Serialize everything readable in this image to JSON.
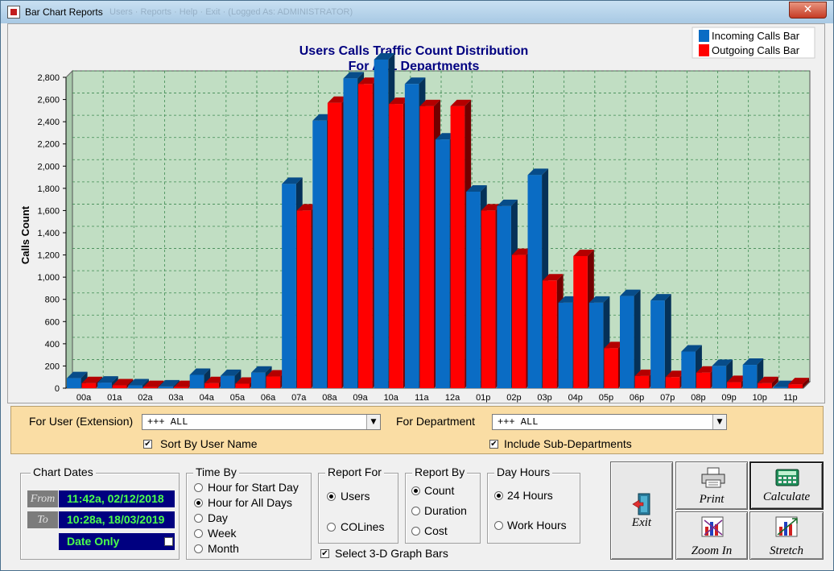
{
  "window": {
    "title": "Bar Chart Reports",
    "menu_ghost": "Users · Reports · Help · Exit · (Logged As: ADMINISTRATOR)",
    "close_glyph": "✕"
  },
  "chart_data": {
    "type": "bar",
    "title": "Users Calls Traffic Count Distribution",
    "subtitle": "For ALL Departments",
    "ylabel": "Calls Count",
    "xlabel": "",
    "ylim": [
      0,
      2800
    ],
    "yticks": [
      "0",
      "200",
      "400",
      "600",
      "800",
      "1,000",
      "1,200",
      "1,400",
      "1,600",
      "1,800",
      "2,000",
      "2,200",
      "2,400",
      "2,600",
      "2,800"
    ],
    "grid": true,
    "legend_position": "top-right",
    "three_d": true,
    "categories": [
      "00a",
      "01a",
      "02a",
      "03a",
      "04a",
      "05a",
      "06a",
      "07a",
      "08a",
      "09a",
      "10a",
      "11a",
      "12a",
      "01p",
      "02p",
      "03p",
      "04p",
      "05p",
      "06p",
      "07p",
      "08p",
      "09p",
      "10p",
      "11p"
    ],
    "series": [
      {
        "name": "Incoming Calls Bar",
        "color": "#0a6cc4",
        "values": [
          90,
          50,
          25,
          15,
          120,
          110,
          140,
          1840,
          2410,
          2790,
          2960,
          2740,
          2240,
          1770,
          1640,
          1920,
          770,
          770,
          830,
          790,
          330,
          200,
          210,
          10
        ]
      },
      {
        "name": "Outgoing Calls Bar",
        "color": "#ff0000",
        "values": [
          45,
          25,
          10,
          10,
          45,
          40,
          105,
          1600,
          2570,
          2740,
          2560,
          2540,
          2540,
          1600,
          1200,
          970,
          1190,
          360,
          110,
          100,
          140,
          55,
          45,
          35
        ]
      }
    ],
    "colors": {
      "plot_bg": "#c1dec3",
      "grid": "#3f8a52",
      "title": "#000080"
    }
  },
  "filters": {
    "user_label": "For User (Extension)",
    "user_value": "+++ ALL",
    "dept_label": "For Department",
    "dept_value": "+++ ALL",
    "sort_label": "Sort By User Name",
    "sort_checked": "✔",
    "subdept_label": "Include Sub-Departments",
    "subdept_checked": "✔"
  },
  "chart_dates": {
    "title": "Chart  Dates",
    "from_tag": "From",
    "from_value": "11:42a, 02/12/2018",
    "to_tag": "To",
    "to_value": "10:28a, 18/03/2019",
    "date_only_label": "Date Only"
  },
  "time_by": {
    "title": "Time By",
    "options": [
      "Hour for Start Day",
      "Hour for All Days",
      "Day",
      "Week",
      "Month"
    ],
    "selected": "Hour for All Days"
  },
  "report_for": {
    "title": "Report For",
    "options": [
      "Users",
      "COLines"
    ],
    "selected": "Users"
  },
  "report_by": {
    "title": "Report By",
    "options": [
      "Count",
      "Duration",
      "Cost"
    ],
    "selected": "Count"
  },
  "day_hours": {
    "title": "Day Hours",
    "options": [
      "24 Hours",
      "Work Hours"
    ],
    "selected": "24 Hours"
  },
  "three_d_option": {
    "label": "Select 3-D Graph Bars",
    "checked": "✔"
  },
  "buttons": {
    "exit": "Exit",
    "print": "Print",
    "calculate": "Calculate",
    "zoom_in": "Zoom In",
    "stretch": "Stretch"
  }
}
